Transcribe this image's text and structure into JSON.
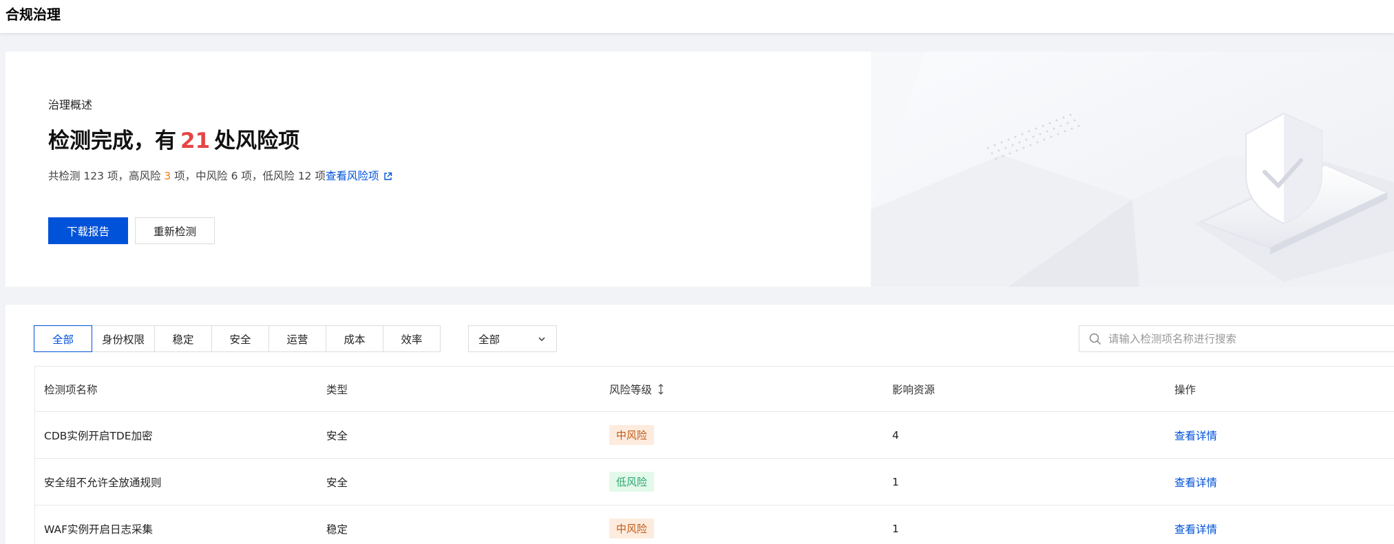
{
  "header": {
    "title": "合规治理"
  },
  "overview": {
    "label": "治理概述",
    "headline_pre": "检测完成，有",
    "risk_count": "21",
    "headline_post": "处风险项",
    "stats_total": "共检测 123 项，高风险 ",
    "stats_high": "3",
    "stats_rest": " 项，中风险 6 项，低风险 12 项",
    "view_link": "查看风险项",
    "download_label": "下载报告",
    "recheck_label": "重新检测"
  },
  "filters": {
    "tabs": [
      "全部",
      "身份权限",
      "稳定",
      "安全",
      "运营",
      "成本",
      "效率"
    ],
    "active_tab": "全部",
    "select_value": "全部",
    "search_placeholder": "请输入检测项名称进行搜索"
  },
  "table": {
    "headers": [
      "检测项名称",
      "类型",
      "风险等级",
      "影响资源",
      "操作"
    ],
    "rows": [
      {
        "name": "CDB实例开启TDE加密",
        "type": "安全",
        "risk": "中风险",
        "risk_level": "medium",
        "resources": "4",
        "action": "查看详情"
      },
      {
        "name": "安全组不允许全放通规则",
        "type": "安全",
        "risk": "低风险",
        "risk_level": "low",
        "resources": "1",
        "action": "查看详情"
      },
      {
        "name": "WAF实例开启日志采集",
        "type": "稳定",
        "risk": "中风险",
        "risk_level": "medium",
        "resources": "1",
        "action": "查看详情"
      }
    ]
  },
  "colors": {
    "primary": "#0052d9",
    "danger": "#e54545",
    "warning": "#ff7d00",
    "success": "#2ba471"
  }
}
